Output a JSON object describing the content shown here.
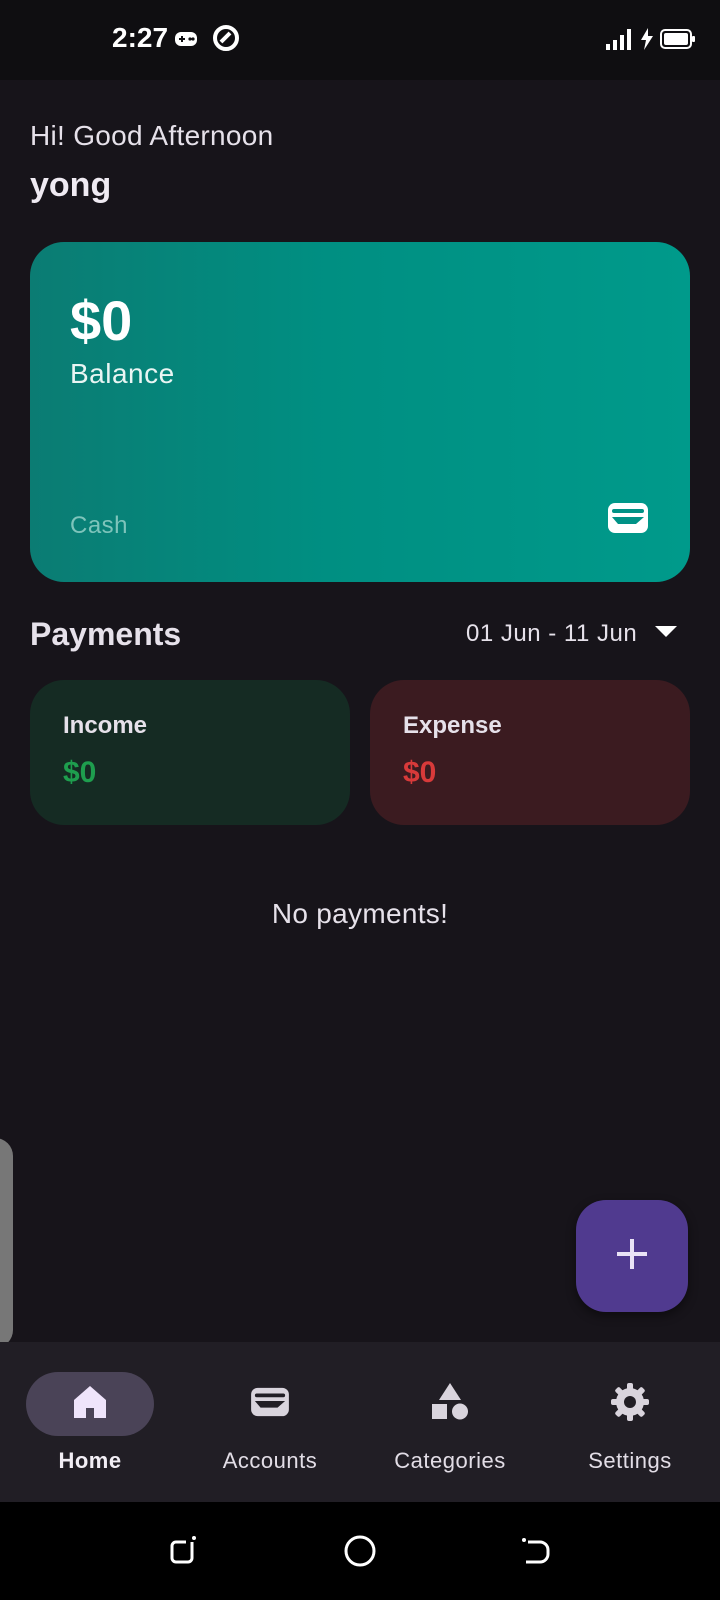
{
  "status_bar": {
    "time": "2:27",
    "icons": [
      "gamepad-icon",
      "app-notification-icon",
      "signal-icon",
      "charging-icon",
      "battery-icon"
    ]
  },
  "header": {
    "greeting": "Hi! Good Afternoon",
    "username": "yong"
  },
  "balance_card": {
    "amount": "$0",
    "label": "Balance",
    "account_name": "Cash",
    "icon": "wallet-icon",
    "gradient": [
      "#0b7c73",
      "#009a8b"
    ]
  },
  "payments": {
    "title": "Payments",
    "date_range": "01 Jun - 11 Jun",
    "income": {
      "label": "Income",
      "value": "$0",
      "color": "#1e9e4e"
    },
    "expense": {
      "label": "Expense",
      "value": "$0",
      "color": "#d83a3a"
    },
    "empty_message": "No payments!"
  },
  "fab": {
    "icon": "plus-icon",
    "color": "#503a8f"
  },
  "bottom_nav": {
    "items": [
      {
        "label": "Home",
        "icon": "home-icon",
        "active": true
      },
      {
        "label": "Accounts",
        "icon": "wallet-icon",
        "active": false
      },
      {
        "label": "Categories",
        "icon": "shapes-icon",
        "active": false
      },
      {
        "label": "Settings",
        "icon": "gear-icon",
        "active": false
      }
    ]
  },
  "system_nav": {
    "buttons": [
      "recents-button",
      "home-button",
      "back-button"
    ]
  },
  "colors": {
    "background": "#17141a",
    "nav_background": "#211e25",
    "accent": "#503a8f"
  }
}
